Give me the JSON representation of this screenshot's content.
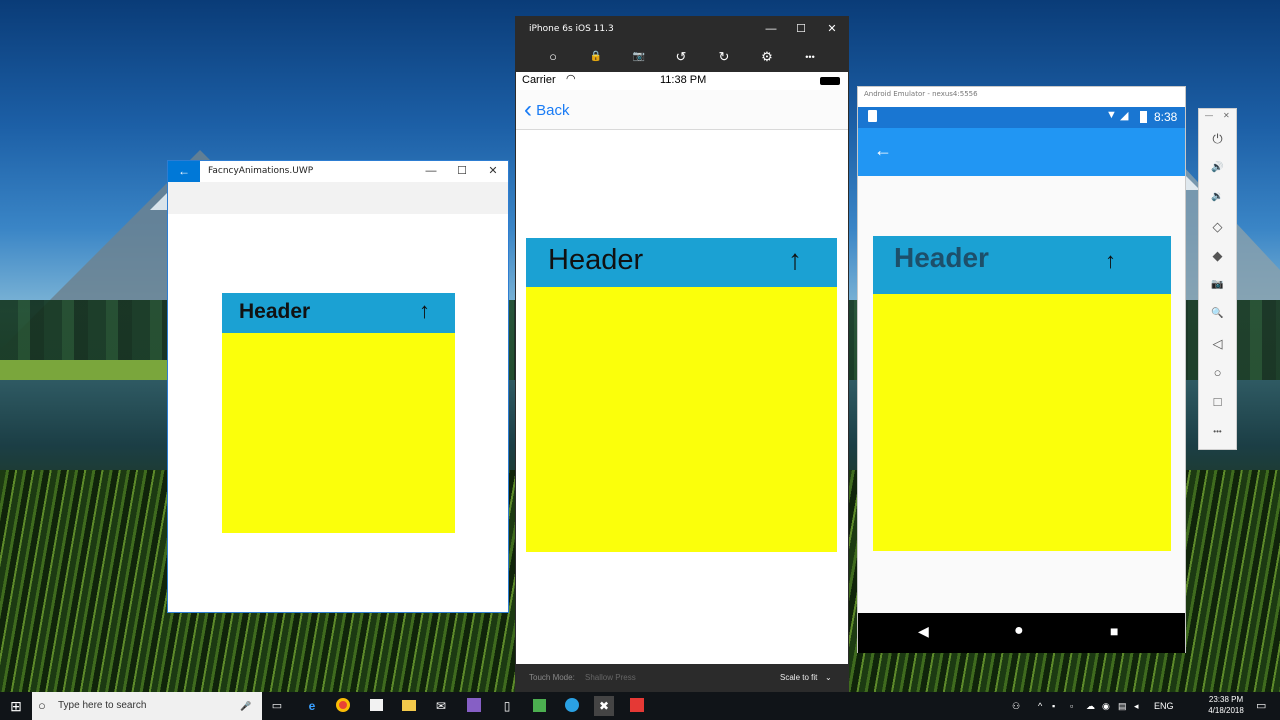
{
  "uwp": {
    "title": "FacncyAnimations.UWP",
    "back_glyph": "←",
    "minimize_glyph": "—",
    "maximize_glyph": "☐",
    "close_glyph": "✕",
    "card": {
      "header": "Header",
      "arrow": "↑"
    }
  },
  "ios": {
    "window_title": "iPhone 6s iOS 11.3",
    "minimize_glyph": "—",
    "maximize_glyph": "☐",
    "close_glyph": "✕",
    "toolbar": {
      "home_glyph": "○",
      "lock_glyph": "🔒",
      "screenshot_glyph": "📷",
      "rotate_left_glyph": "↺",
      "rotate_right_glyph": "↻",
      "settings_glyph": "⚙",
      "more_glyph": "•••"
    },
    "status": {
      "carrier": "Carrier",
      "time": "11:38 PM"
    },
    "nav": {
      "back_chevron": "‹",
      "back_label": "Back"
    },
    "card": {
      "header": "Header",
      "arrow": "↑"
    },
    "bottom": {
      "touch_mode_label": "Touch Mode:",
      "touch_mode_value": "Shallow Press",
      "scale_label": "Scale to fit",
      "scale_chevron": "⌄"
    }
  },
  "android": {
    "window_title": "Android Emulator - nexus4:5556",
    "status": {
      "time": "8:38"
    },
    "appbar": {
      "back_glyph": "←"
    },
    "card": {
      "header": "Header",
      "arrow": "↑"
    },
    "nav": {
      "back_glyph": "◀",
      "home_glyph": "●",
      "recents_glyph": "■"
    },
    "side": {
      "close_glyph": "✕",
      "minimize_glyph": "—",
      "buttons": [
        "⏻",
        "🔊",
        "🔉",
        "◇",
        "◆",
        "📷",
        "🔍",
        "◁",
        "○",
        "□",
        "•••"
      ]
    }
  },
  "taskbar": {
    "start_glyph": "⊞",
    "search_placeholder": "Type here to search",
    "search_icon": "○",
    "mic_glyph": "🎤",
    "time": "23:38 PM",
    "date": "4/18/2018",
    "lang": "ENG"
  },
  "colors": {
    "card_header": "#1ba1d3",
    "card_body": "#fbff0b",
    "uwp_accent": "#0078d7",
    "ios_link": "#1a7cf5",
    "android_primary": "#2196f3",
    "android_status": "#1976d2"
  }
}
